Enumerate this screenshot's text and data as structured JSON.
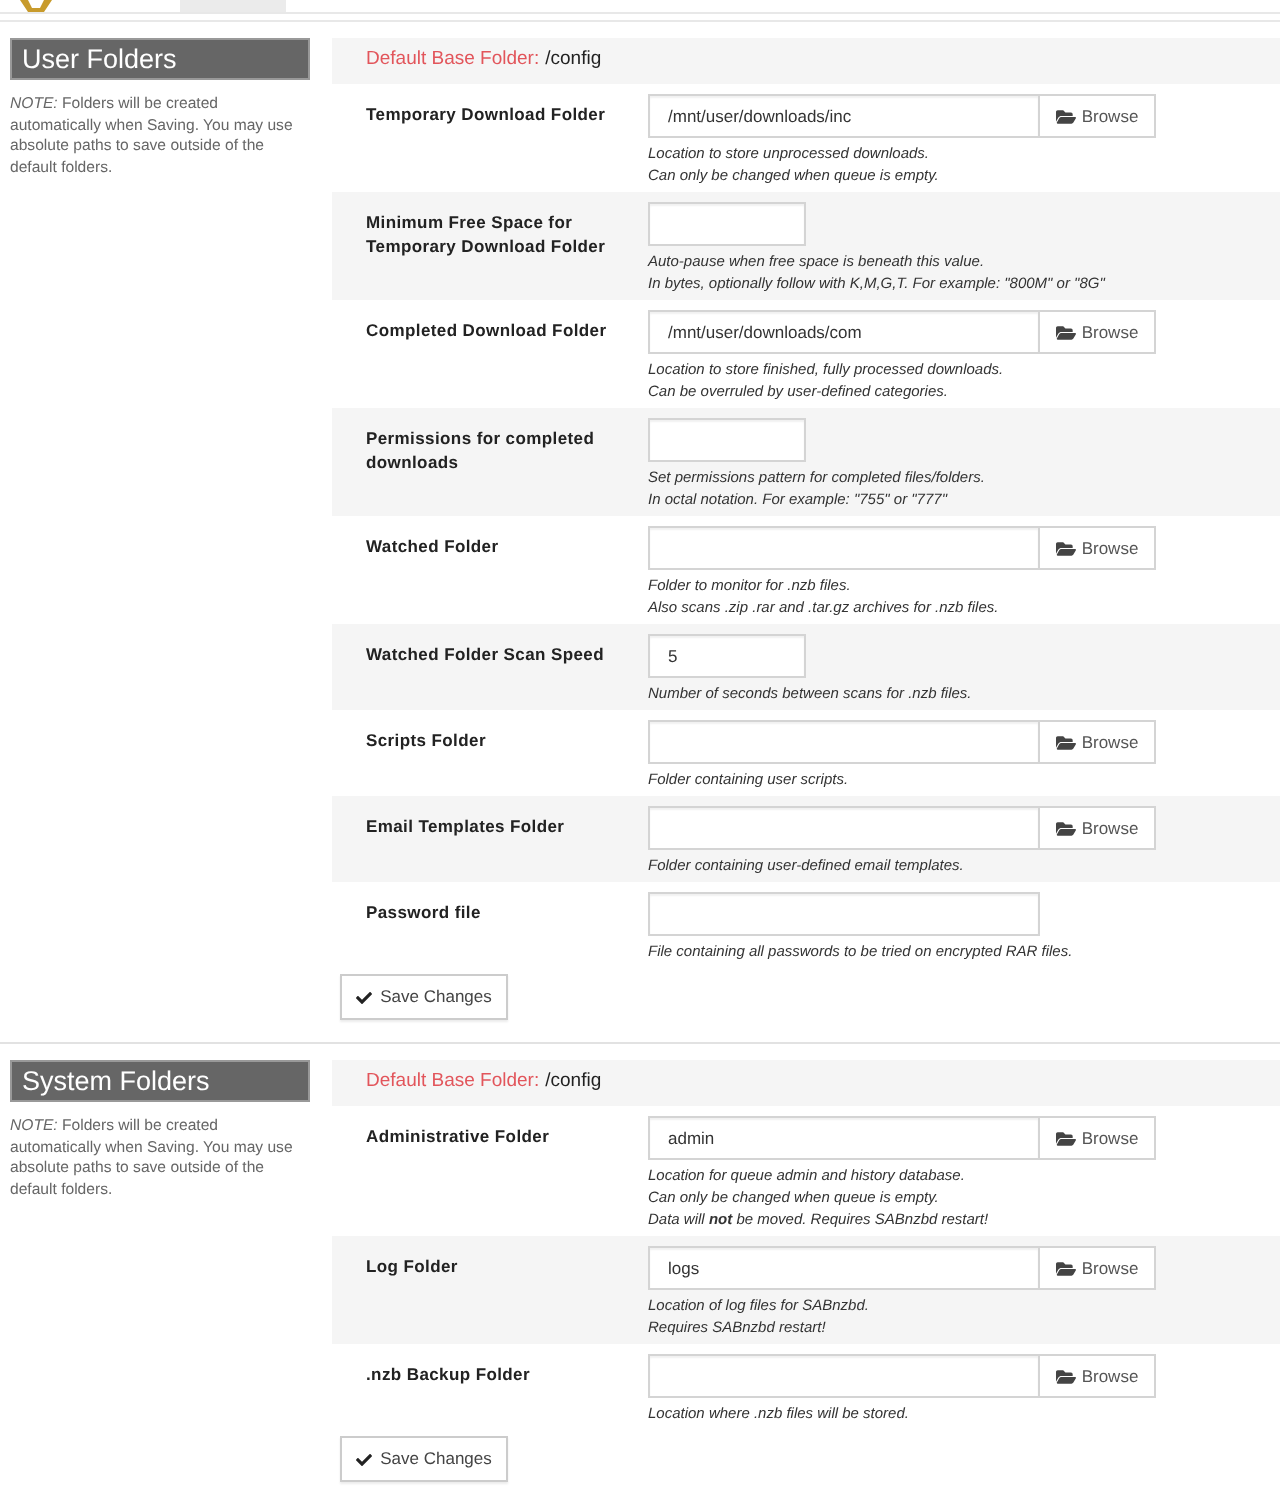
{
  "sections": [
    {
      "title": "User Folders",
      "note": "*NOTE:* Folders will be created automatically when Saving. You may use absolute paths to save outside of the default folders.",
      "base_folder": {
        "label": "Default Base Folder:",
        "value": "/config"
      },
      "fields": [
        {
          "kind": "browse",
          "label": "Temporary Download Folder",
          "value": "/mnt/user/downloads/inc",
          "button": "Browse",
          "help": [
            "Location to store unprocessed downloads.",
            "Can only be changed when queue is empty."
          ]
        },
        {
          "kind": "short",
          "label": "Minimum Free Space for Temporary Download Folder",
          "help": [
            "Auto-pause when free space is beneath this value.",
            "In bytes, optionally follow with K,M,G,T. For example: \"800M\" or \"8G\""
          ]
        },
        {
          "kind": "browse",
          "label": "Completed Download Folder",
          "value": "/mnt/user/downloads/com",
          "button": "Browse",
          "help": [
            "Location to store finished, fully processed downloads.",
            "Can be overruled by user-defined categories."
          ]
        },
        {
          "kind": "short",
          "label": "Permissions for completed downloads",
          "help": [
            "Set permissions pattern for completed files/folders.",
            "In octal notation. For example: \"755\" or \"777\""
          ]
        },
        {
          "kind": "browse",
          "label": "Watched Folder",
          "button": "Browse",
          "help": [
            "Folder to monitor for .nzb files.",
            "Also scans .zip .rar and .tar.gz archives for .nzb files."
          ]
        },
        {
          "kind": "short",
          "label": "Watched Folder Scan Speed",
          "value": "5",
          "help": [
            "Number of seconds between scans for .nzb files."
          ]
        },
        {
          "kind": "browse",
          "label": "Scripts Folder",
          "button": "Browse",
          "help": [
            "Folder containing user scripts."
          ]
        },
        {
          "kind": "browse",
          "label": "Email Templates Folder",
          "button": "Browse",
          "help": [
            "Folder containing user-defined email templates."
          ]
        },
        {
          "kind": "wide",
          "label": "Password file",
          "help": [
            "File containing all passwords to be tried on encrypted RAR files."
          ]
        }
      ],
      "save_button": "Save Changes"
    },
    {
      "title": "System Folders",
      "note": "*NOTE:* Folders will be created automatically when Saving. You may use absolute paths to save outside of the default folders.",
      "base_folder": {
        "label": "Default Base Folder:",
        "value": "/config"
      },
      "fields": [
        {
          "kind": "browse",
          "label": "Administrative Folder",
          "value": "admin",
          "button": "Browse",
          "help": [
            "Location for queue admin and history database.",
            "Can only be changed when queue is empty.",
            "Data will **not** be moved. Requires SABnzbd restart!"
          ]
        },
        {
          "kind": "browse",
          "label": "Log Folder",
          "value": "logs",
          "button": "Browse",
          "help": [
            "Location of log files for SABnzbd.",
            "Requires SABnzbd restart!"
          ]
        },
        {
          "kind": "browse",
          "label": ".nzb Backup Folder",
          "button": "Browse",
          "help": [
            "Location where .nzb files will be stored."
          ]
        }
      ],
      "save_button": "Save Changes"
    }
  ]
}
